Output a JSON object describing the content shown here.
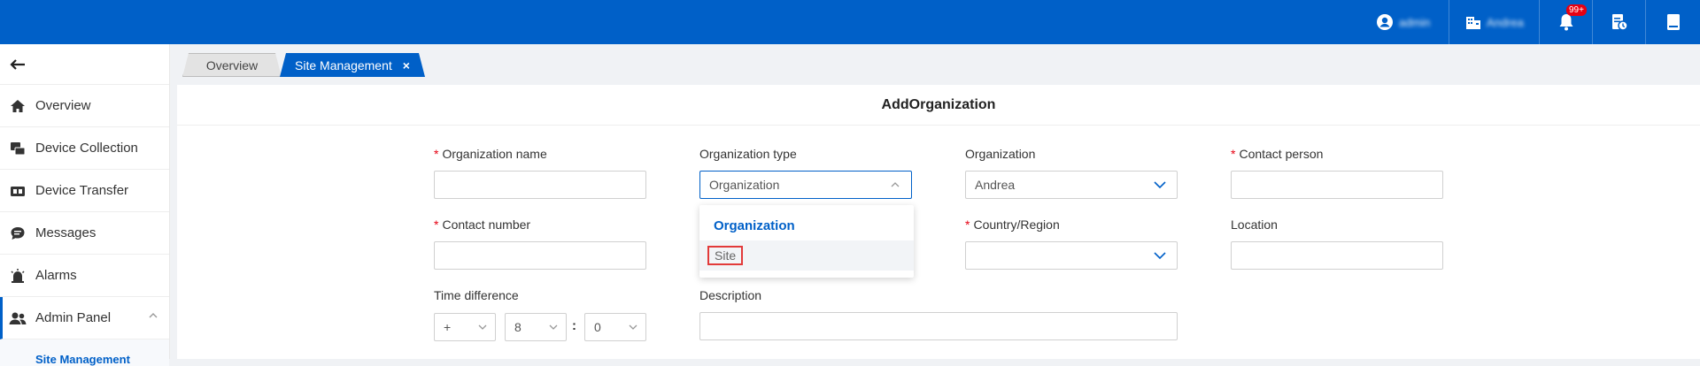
{
  "topbar": {
    "user_name": "admin",
    "org_name": "Andrea",
    "notification_badge": "99+"
  },
  "sidebar": {
    "items": [
      {
        "label": "Overview"
      },
      {
        "label": "Device Collection"
      },
      {
        "label": "Device Transfer"
      },
      {
        "label": "Messages"
      },
      {
        "label": "Alarms"
      },
      {
        "label": "Admin Panel"
      }
    ],
    "sub_item": "Site Management"
  },
  "tabs": [
    {
      "label": "Overview"
    },
    {
      "label": "Site Management"
    }
  ],
  "tab_close_symbol": "×",
  "form": {
    "title": "AddOrganization",
    "org_name_label": "Organization name",
    "org_type_label": "Organization type",
    "org_type_value": "Organization",
    "organization_label": "Organization",
    "organization_value": "Andrea",
    "contact_person_label": "Contact person",
    "contact_number_label": "Contact number",
    "country_label": "Country/Region",
    "location_label": "Location",
    "time_diff_label": "Time difference",
    "time_sign": "+",
    "time_hour": "8",
    "time_minute": "0",
    "time_colon": ":",
    "description_label": "Description",
    "required_mark": "*"
  },
  "dropdown": {
    "options": [
      "Organization",
      "Site"
    ]
  },
  "colors": {
    "brand": "#0060c8",
    "required": "#e60012",
    "highlight": "#e23a3a"
  }
}
